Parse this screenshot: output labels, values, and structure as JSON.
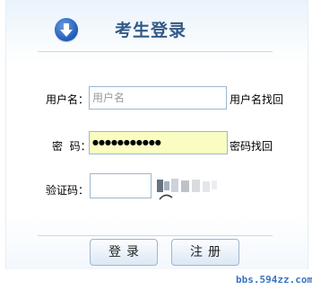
{
  "header": {
    "title": "考生登录",
    "icon": "download-arrow-icon"
  },
  "form": {
    "username": {
      "label": "用户名：",
      "placeholder": "用户名",
      "value": "",
      "recover_link": "用户名找回"
    },
    "password": {
      "label": "密  码：",
      "value": "●●●●●●●●●●●",
      "recover_link": "密码找回"
    },
    "captcha": {
      "label": "验证码：",
      "value": "",
      "image": "captcha-image"
    }
  },
  "actions": {
    "login_label": "登录",
    "register_label": "注册"
  },
  "watermark": "bbs.594zz.com",
  "colors": {
    "title": "#335a86",
    "password_bg": "#fafdc2",
    "accent": "#1d5ab8",
    "watermark": "#3a74c4"
  }
}
